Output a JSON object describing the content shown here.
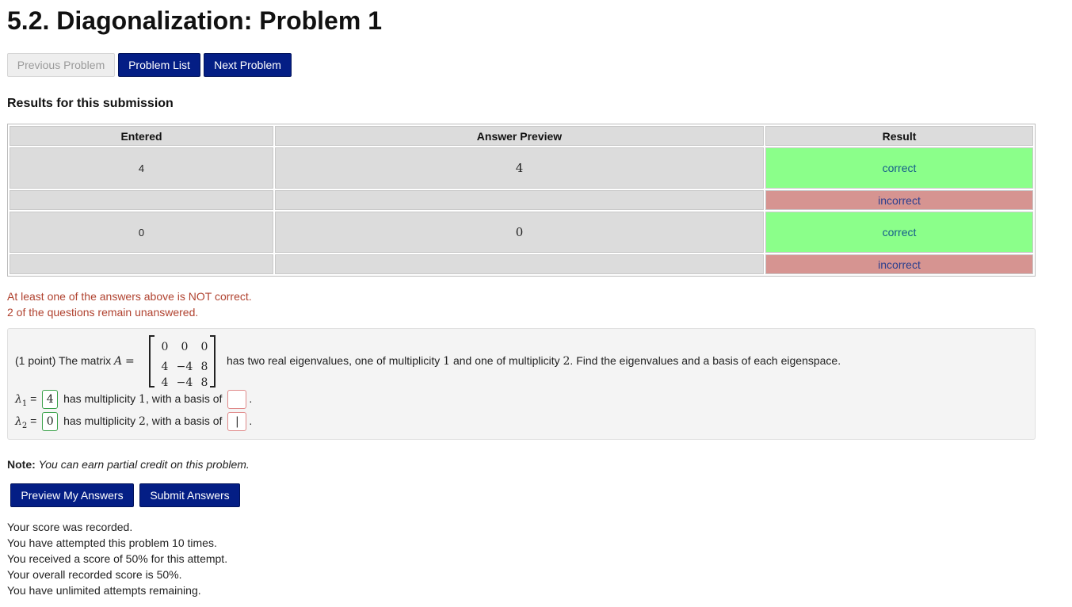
{
  "title": "5.2. Diagonalization: Problem 1",
  "nav": {
    "previous": "Previous Problem",
    "list": "Problem List",
    "next": "Next Problem"
  },
  "results": {
    "heading": "Results for this submission",
    "columns": [
      "Entered",
      "Answer Preview",
      "Result"
    ],
    "rows": [
      {
        "entered": "4",
        "preview": "4",
        "result": "correct"
      },
      {
        "entered": "",
        "preview": "",
        "result": "incorrect"
      },
      {
        "entered": "0",
        "preview": "0",
        "result": "correct"
      },
      {
        "entered": "",
        "preview": "",
        "result": "incorrect"
      }
    ]
  },
  "messages": {
    "not_correct": "At least one of the answers above is NOT correct.",
    "unanswered": "2 of the questions remain unanswered."
  },
  "problem": {
    "points": "(1 point) The matrix",
    "matrix_symbol": "A",
    "equals": "=",
    "matrix": [
      [
        "0",
        "0",
        "0"
      ],
      [
        "4",
        "−4",
        "8"
      ],
      [
        "4",
        "−4",
        "8"
      ]
    ],
    "text_a": "has two real eigenvalues, one of multiplicity",
    "mult_one": "1",
    "text_b": "and one of multiplicity",
    "mult_two": "2",
    "text_c": ". Find the eigenvalues and a basis of each eigenspace.",
    "lambda1": {
      "symbol": "λ",
      "sub": "1",
      "eq": "=",
      "value": "4",
      "text_a": "has multiplicity",
      "mult": "1",
      "text_b": ", with a basis of",
      "basis": "",
      "period": "."
    },
    "lambda2": {
      "symbol": "λ",
      "sub": "2",
      "eq": "=",
      "value": "0",
      "text_a": "has multiplicity",
      "mult": "2",
      "text_b": ", with a basis of",
      "basis": "|",
      "period": "."
    }
  },
  "note": {
    "label": "Note:",
    "text": "You can earn partial credit on this problem."
  },
  "actions": {
    "preview": "Preview My Answers",
    "submit": "Submit Answers"
  },
  "status": [
    "Your score was recorded.",
    "You have attempted this problem 10 times.",
    "You received a score of 50% for this attempt.",
    "Your overall recorded score is 50%.",
    "You have unlimited attempts remaining."
  ]
}
